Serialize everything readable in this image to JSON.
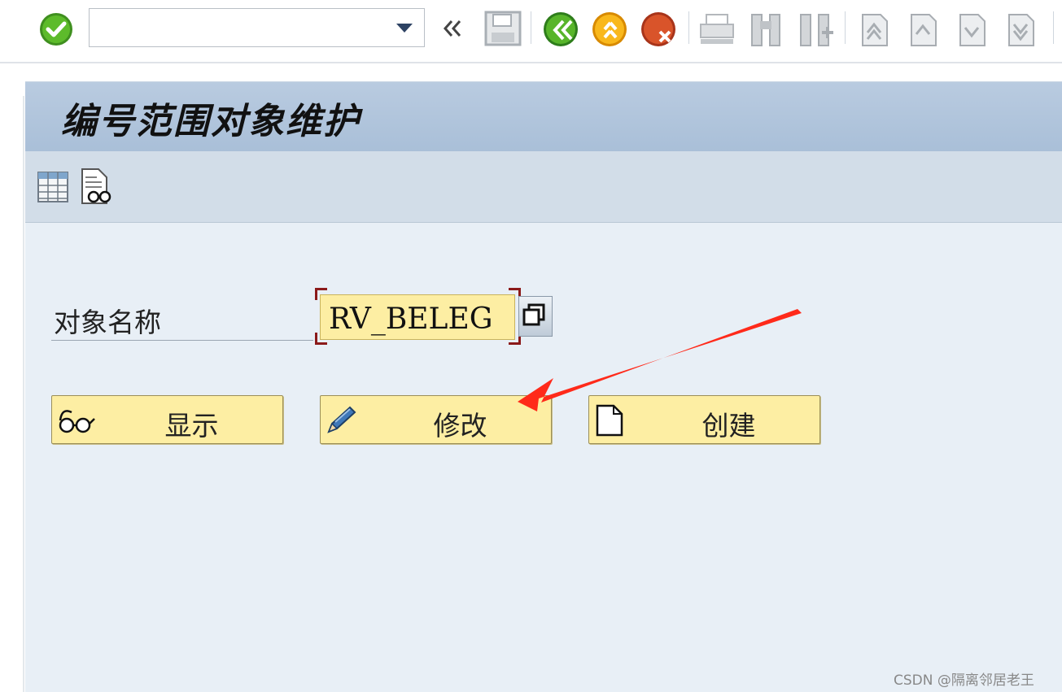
{
  "toolbar": {
    "command_value": "",
    "icons": [
      "enter-icon",
      "back-icon",
      "save-icon",
      "back-green-icon",
      "exit-icon",
      "cancel-icon",
      "print-icon",
      "find-icon",
      "find-next-icon",
      "first-page-icon",
      "prev-page-icon",
      "next-page-icon",
      "last-page-icon"
    ]
  },
  "page": {
    "title": "编号范围对象维护"
  },
  "app_toolbar": {
    "icons": [
      "table-icon",
      "display-document-icon"
    ]
  },
  "form": {
    "object_label": "对象名称",
    "object_value": "RV_BELEG"
  },
  "buttons": {
    "display": "显示",
    "change": "修改",
    "create": "创建"
  },
  "annotation": {
    "arrow_color": "#ff2a1a"
  },
  "watermark": "CSDN @隔离邻居老王"
}
